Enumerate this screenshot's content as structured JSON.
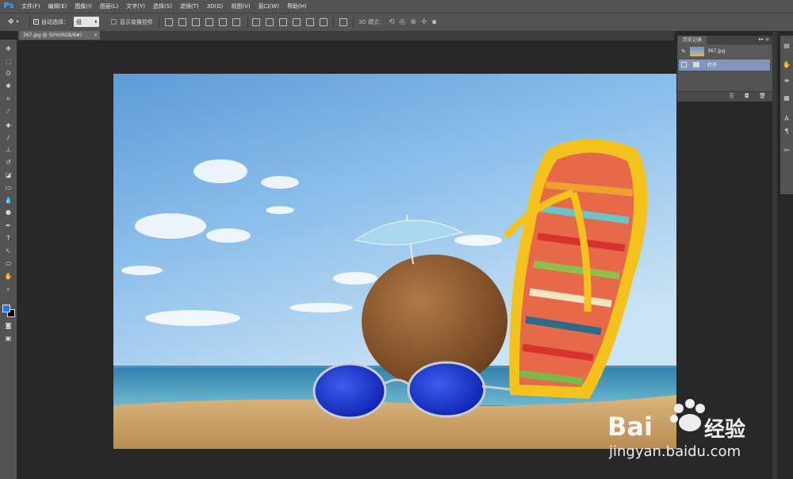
{
  "app": {
    "logo": "Ps"
  },
  "menu": [
    "文件(F)",
    "编辑(E)",
    "图像(I)",
    "图层(L)",
    "文字(Y)",
    "选择(S)",
    "滤镜(T)",
    "3D(D)",
    "视图(V)",
    "窗口(W)",
    "帮助(H)"
  ],
  "options": {
    "auto_select_label": "自动选择：",
    "auto_select_value": "组",
    "show_transform_label": "显示变换控件",
    "mode_3d_label": "3D 模式："
  },
  "document": {
    "tab_title": "367.jpg @ 50%(RGB/8#)",
    "close": "×"
  },
  "colors": {
    "foreground": "#1e7ee6",
    "background": "#000000",
    "accent": "#31a8ff"
  },
  "history_panel": {
    "tab_label": "历史记录",
    "snapshot_name": "367.jpg",
    "items": [
      "打开"
    ]
  },
  "watermark": {
    "brand": "Bai",
    "brand2": "经验",
    "url": "jingyan.baidu.com"
  }
}
